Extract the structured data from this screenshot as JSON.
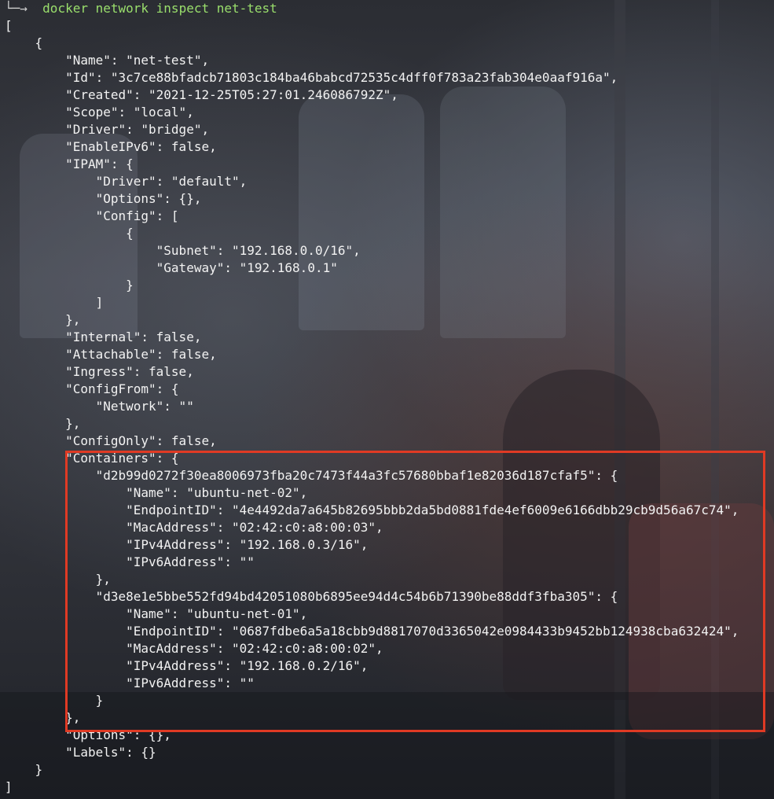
{
  "terminal": {
    "prompt_arrow": "└─→",
    "command": "docker network inspect net-test",
    "output_lines": [
      "[",
      "    {",
      "        \"Name\": \"net-test\",",
      "        \"Id\": \"3c7ce88bfadcb71803c184ba46babcd72535c4dff0f783a23fab304e0aaf916a\",",
      "        \"Created\": \"2021-12-25T05:27:01.246086792Z\",",
      "        \"Scope\": \"local\",",
      "        \"Driver\": \"bridge\",",
      "        \"EnableIPv6\": false,",
      "        \"IPAM\": {",
      "            \"Driver\": \"default\",",
      "            \"Options\": {},",
      "            \"Config\": [",
      "                {",
      "                    \"Subnet\": \"192.168.0.0/16\",",
      "                    \"Gateway\": \"192.168.0.1\"",
      "                }",
      "            ]",
      "        },",
      "        \"Internal\": false,",
      "        \"Attachable\": false,",
      "        \"Ingress\": false,",
      "        \"ConfigFrom\": {",
      "            \"Network\": \"\"",
      "        },",
      "        \"ConfigOnly\": false,",
      "        \"Containers\": {",
      "            \"d2b99d0272f30ea8006973fba20c7473f44a3fc57680bbaf1e82036d187cfaf5\": {",
      "                \"Name\": \"ubuntu-net-02\",",
      "                \"EndpointID\": \"4e4492da7a645b82695bbb2da5bd0881fde4ef6009e6166dbb29cb9d56a67c74\",",
      "                \"MacAddress\": \"02:42:c0:a8:00:03\",",
      "                \"IPv4Address\": \"192.168.0.3/16\",",
      "                \"IPv6Address\": \"\"",
      "            },",
      "            \"d3e8e1e5bbe552fd94bd42051080b6895ee94d4c54b6b71390be88ddf3fba305\": {",
      "                \"Name\": \"ubuntu-net-01\",",
      "                \"EndpointID\": \"0687fdbe6a5a18cbb9d8817070d3365042e0984433b9452bb124938cba632424\",",
      "                \"MacAddress\": \"02:42:c0:a8:00:02\",",
      "                \"IPv4Address\": \"192.168.0.2/16\",",
      "                \"IPv6Address\": \"\"",
      "            }",
      "        },",
      "        \"Options\": {},",
      "        \"Labels\": {}",
      "    }",
      "]"
    ]
  },
  "colors": {
    "command": "#9adf6c",
    "text": "#f2f2f2",
    "highlight_border": "#e03a24"
  }
}
